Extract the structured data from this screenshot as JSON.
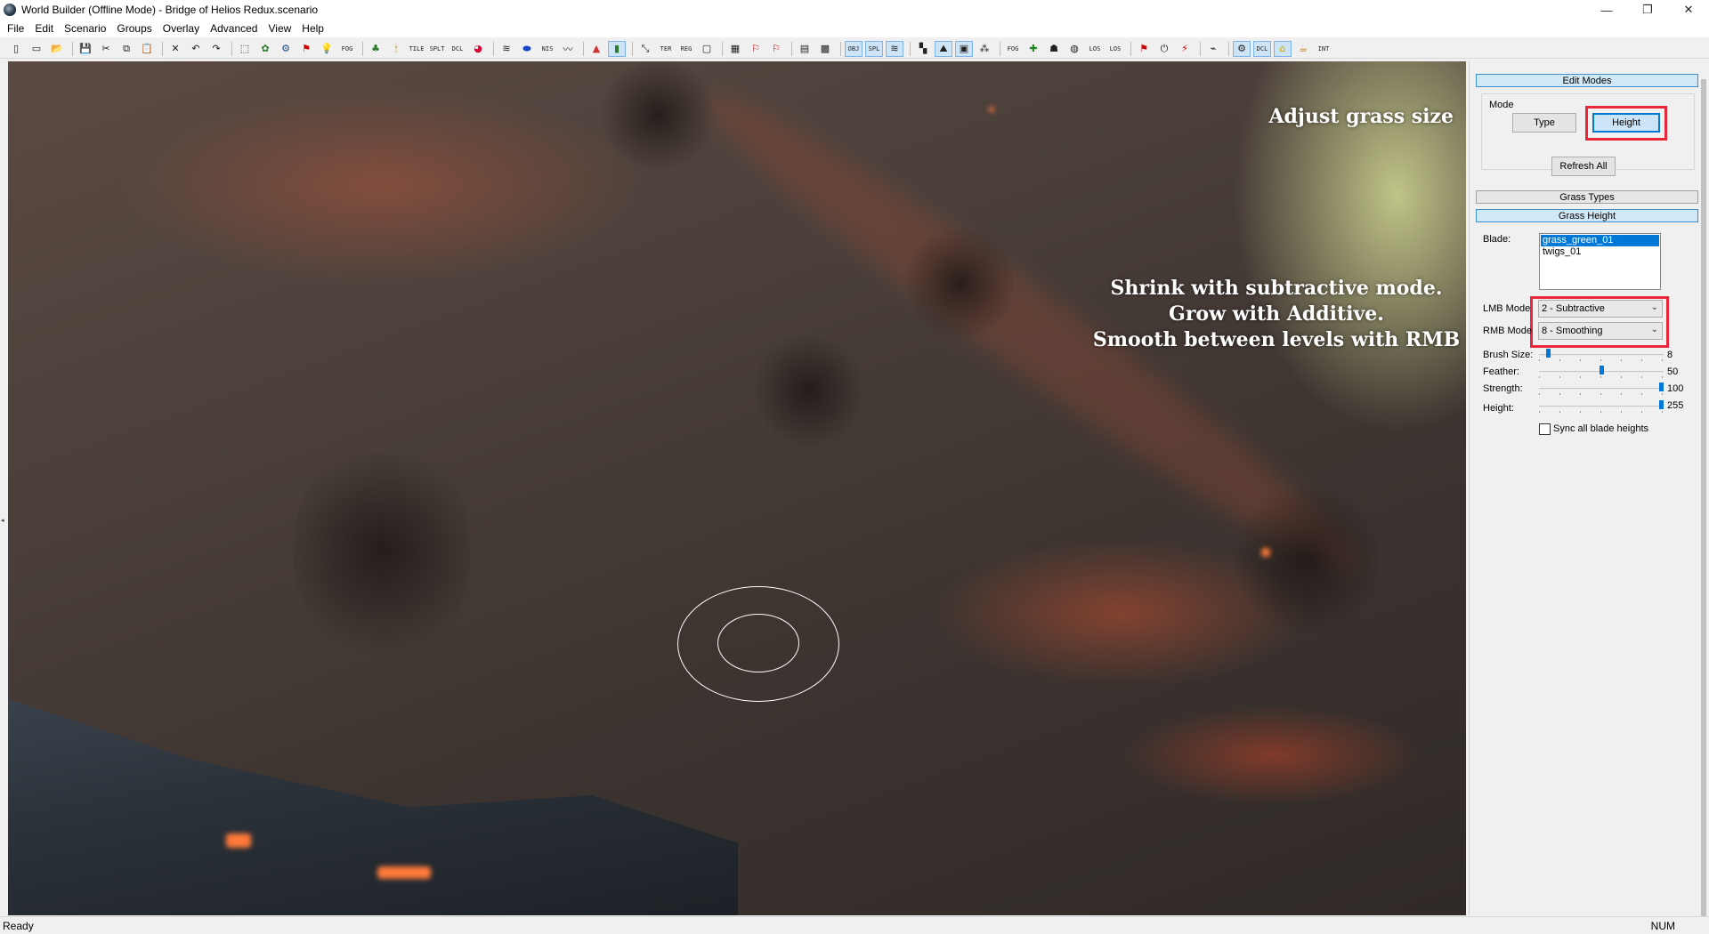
{
  "window": {
    "title": "World Builder (Offline Mode) - Bridge of Helios Redux.scenario",
    "minimize": "—",
    "restore": "❐",
    "close": "✕"
  },
  "menu": [
    "File",
    "Edit",
    "Scenario",
    "Groups",
    "Overlay",
    "Advanced",
    "View",
    "Help"
  ],
  "toolbar_labels": {
    "fog": "FOG",
    "tile": "TILE",
    "splt": "SPLT",
    "dcl": "DCL",
    "nis": "NIS",
    "ter": "TER",
    "reg": "REG",
    "obj": "OBJ",
    "spl": "SPL",
    "fog2": "FOG",
    "los": "LOS",
    "los2": "LOS",
    "dcl2": "DCL",
    "int": "INT"
  },
  "viewport": {
    "overlay_title": "Adjust grass size",
    "overlay_lines": [
      "Shrink with subtractive mode.",
      "Grow with Additive.",
      "Smooth between levels with RMB"
    ]
  },
  "panel": {
    "edit_modes": "Edit Modes",
    "mode_label": "Mode",
    "type_button": "Type",
    "height_button": "Height",
    "refresh_all": "Refresh All",
    "grass_types": "Grass Types",
    "grass_height": "Grass Height",
    "blade_label": "Blade:",
    "blades": [
      "grass_green_01",
      "twigs_01"
    ],
    "lmb_label": "LMB Mode",
    "lmb_value": "2 - Subtractive",
    "rmb_label": "RMB Mode",
    "rmb_value": "8 - Smoothing",
    "sliders": [
      {
        "label": "Brush Size:",
        "value": "8",
        "level": 0.06
      },
      {
        "label": "Feather:",
        "value": "50",
        "level": 0.5
      },
      {
        "label": "Strength:",
        "value": "100",
        "level": 1.0
      },
      {
        "label": "Height:",
        "value": "255",
        "level": 1.0
      }
    ],
    "sync_label": "Sync all blade heights"
  },
  "status": {
    "text": "Ready",
    "num": "NUM"
  },
  "colors": {
    "highlight": "#e8283a",
    "accent": "#0078d7"
  }
}
